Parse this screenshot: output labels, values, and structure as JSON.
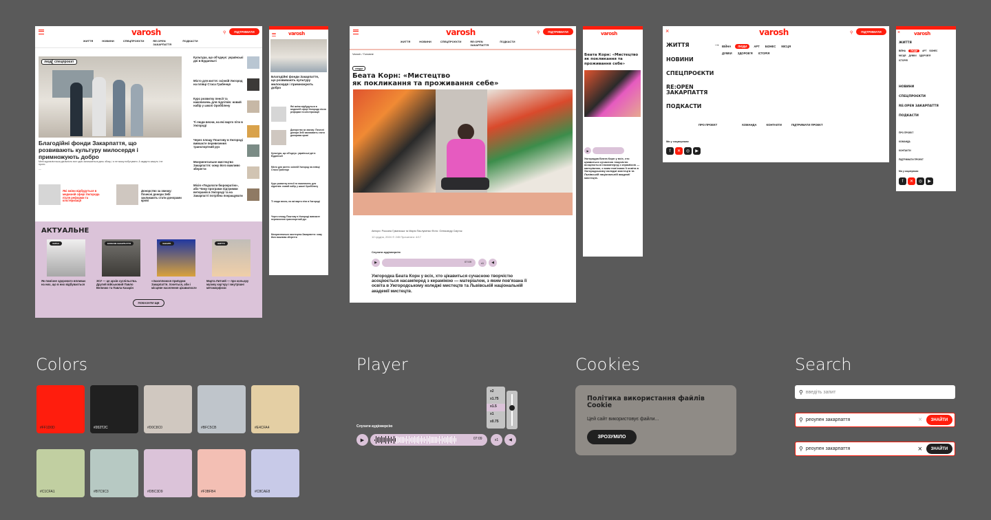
{
  "brand": {
    "logo": "varosh",
    "support_label": "ПІДТРИМАТИ",
    "accent": "#ff1d0d"
  },
  "nav": [
    "ЖИТТЯ",
    "НОВИНИ",
    "СПЕЦПРОЄКТИ",
    "RE:OPEN ЗАКАРПАТТЯ",
    "ПОДКАСТИ"
  ],
  "home": {
    "hero_title": "Благодійні фонди Закарпаття, що розвивають культуру милосердя і примножують добро",
    "hero_excerpt": "Мені журналістська діяльність все одно залишається десь збоку, і я не можу побутувати. А задарто кажуть і не проти.",
    "hero_tags": [
      "люди",
      "спецпроєкт"
    ],
    "side_news": [
      "Культура, що об'єднує: українські дні в Будапешті",
      "Місто для життя: осінній Ужгород на плівці Стаса Грабенця",
      "Курс розвитку пенсії та накопичень для підлітків: новий набір у школі Оробблену",
      "Ті люди весни, на які варто піти в Ужгороді",
      "Через площу Поштову в Ужгороді вивчаєте перевезення транспортний рух",
      "Монументальне мистецтво Закарпаття: чому його важливо зберегти",
      "Місія «Подолати бюрократію», або Чому програми підтримки ветеранів в Ужгороді та на Закарпатті потрібна покращувати"
    ],
    "mid_news": [
      "Які зміни відбудуться в медичній сфері Ужгорода після реформи та клістеризації",
      "Донорство за звичку: Почесні донори Зебі закликають стати донорами крові"
    ],
    "actual_title": "АКТУАЛЬНЕ",
    "actual_items": [
      {
        "tag": "ЗАРАЗ",
        "title": "Як помічне здорового впливає на них, що в них відбувається"
      },
      {
        "tag": "ЕКОНОМ.ЗАКАРПАТТЯ",
        "title": "ЗСУ — це архів суспільства. Другий військовий Павло Величко та Павла Казарін"
      },
      {
        "tag": "ЗАКАРП.",
        "title": "«Захоплююся приїздом Закарпаття. Хочеться, аби і місцеве населення цікавилося»"
      },
      {
        "tag": "ЖИТТЯ",
        "title": "Марта Литчей — про кольору музику карʼєру і внутрішні метаморфози"
      }
    ],
    "show_more": "ПОКАЗАТИ ЩЕ"
  },
  "article": {
    "breadcrumb": "Varosh / Головне",
    "tag": "люди",
    "title_line1": "Беата Корн: «Мистецтво",
    "title_line2": "як покликання та проживання себе»",
    "authors": "Автори: Роксана Гуманська та Марія Паслуяенко  Фото: Олександр Смуток",
    "date": "12 грудня, 2024   ⊙ 245   Прочитати: 4/17",
    "listen_label": "Слухати аудіоверсію",
    "time": "07:09",
    "speed": "x1",
    "lead": "Ужгородка Беата Корн у всіх, хто цікавиться сучасною творчістю асоціюється насамперед з керамікою — матеріалом, з яким пов'язана її освіта в Ужгородському коледжі мистецтв та Львівській національній академії мистецтв."
  },
  "article_mobile": {
    "title": "Беата Корн: «Мистецтво як покликання та проживання себе»"
  },
  "menu": {
    "items": [
      "ЖИТТЯ",
      "НОВИНИ",
      "СПЕЦПРОЄКТИ",
      "RE:OPEN ЗАКАРПАТТЯ",
      "ПОДКАСТИ"
    ],
    "sub_items": [
      "ВІЙНА",
      "ЛЮДИ",
      "АРТ",
      "БІЗНЕС",
      "МІСЦЯ",
      "ДУМКИ",
      "ЗДОРОВ'Я",
      "ІСТОРІЯ"
    ],
    "footer_links": [
      "ПРО ПРОЕКТ",
      "КОМАНДА",
      "КОНТАКТИ",
      "ПІДТРИМАТИ ПРОЕКТ"
    ],
    "social_label": "Ми у соцмережах"
  },
  "sections": {
    "colors": "Colors",
    "player": "Player",
    "cookies": "Cookies",
    "search": "Search"
  },
  "colors": [
    {
      "hex": "#FF1D0D",
      "label": "#FF1D0D"
    },
    {
      "hex": "#202020",
      "label": "#202T2C"
    },
    {
      "hex": "#D0C8C0",
      "label": "#D0C8C0"
    },
    {
      "hex": "#BFC5CB",
      "label": "#BFC5CB"
    },
    {
      "hex": "#E4CFA4",
      "label": "#E4CFA4"
    },
    {
      "hex": "#C1CFA1",
      "label": "#C1CFA1"
    },
    {
      "hex": "#B7C9C3",
      "label": "#B7C9C3"
    },
    {
      "hex": "#DBC3D9",
      "label": "#DBC3D9"
    },
    {
      "hex": "#F3BFB4",
      "label": "#F3BFB4"
    },
    {
      "hex": "#C8CAE8",
      "label": "#C8CAE8"
    }
  ],
  "player": {
    "listen_label": "Слухати аудіоверсію",
    "time": "07:09",
    "speed": "x1",
    "speeds": [
      "x2",
      "x1.75",
      "x1.5",
      "x1",
      "x0.75"
    ],
    "selected_speed": "x1.5",
    "volume": 0.6
  },
  "cookies": {
    "title": "Політика використання файлів Cookie",
    "text": "Цей сайт використовує файли...",
    "button": "ЗРОЗУМІЛО"
  },
  "search": {
    "placeholder": "введіть запит",
    "query": "реоупен закарпаття",
    "button": "ЗНАЙТИ"
  }
}
